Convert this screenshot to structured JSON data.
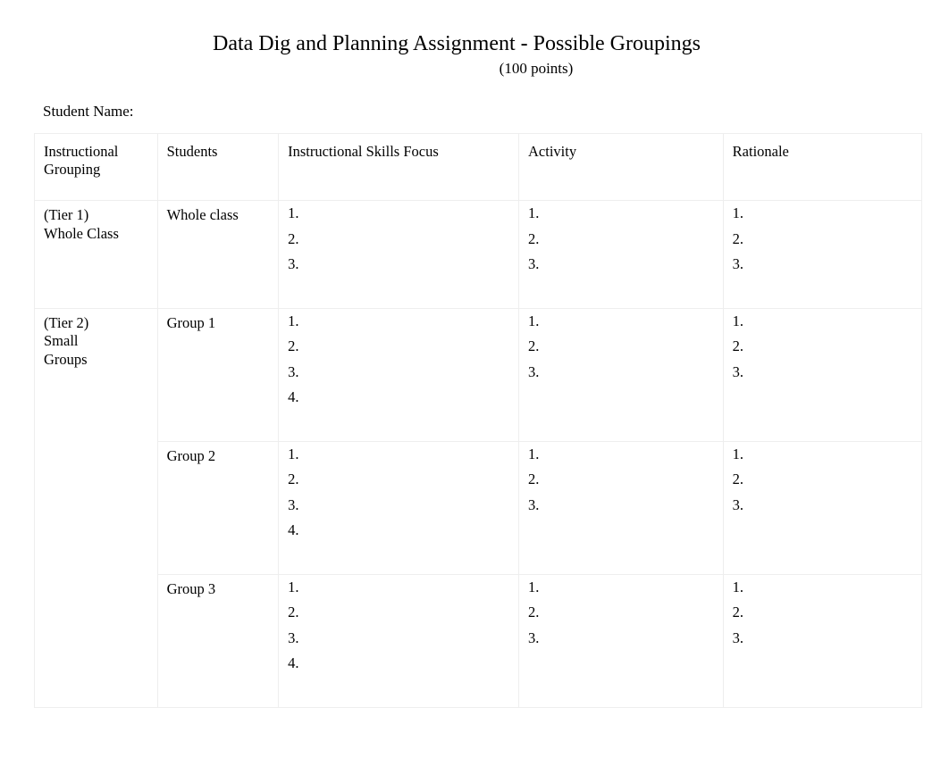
{
  "title": "Data Dig and Planning Assignment - Possible Groupings",
  "subtitle": "(100 points)",
  "student_name_label": "Student Name:",
  "headers": {
    "grouping": "Instructional Grouping",
    "students": "Students",
    "skills": "Instructional Skills Focus",
    "activity": "Activity",
    "rationale": "Rationale"
  },
  "rows": {
    "tier1": {
      "grouping_line1": "(Tier 1)",
      "grouping_line2": "Whole Class",
      "students": "Whole class",
      "skills": [
        "1.",
        "2.",
        "3."
      ],
      "activity": [
        "1.",
        "2.",
        "3."
      ],
      "rationale": [
        "1.",
        "2.",
        "3."
      ]
    },
    "tier2": {
      "grouping_line1": "(Tier 2)",
      "grouping_line2": "Small",
      "grouping_line3": "Groups",
      "group1": {
        "students": "Group 1",
        "skills": [
          "1.",
          "2.",
          "3.",
          "4."
        ],
        "activity": [
          "1.",
          "2.",
          "3."
        ],
        "rationale": [
          "1.",
          "2.",
          "3."
        ]
      },
      "group2": {
        "students": "Group 2",
        "skills": [
          "1.",
          "2.",
          "3.",
          "4."
        ],
        "activity": [
          "1.",
          "2.",
          "3."
        ],
        "rationale": [
          "1.",
          "2.",
          "3."
        ]
      },
      "group3": {
        "students": "Group 3",
        "skills": [
          "1.",
          "2.",
          "3.",
          "4."
        ],
        "activity": [
          "1.",
          "2.",
          "3."
        ],
        "rationale": [
          "1.",
          "2.",
          "3."
        ]
      }
    }
  },
  "footer_text": ""
}
